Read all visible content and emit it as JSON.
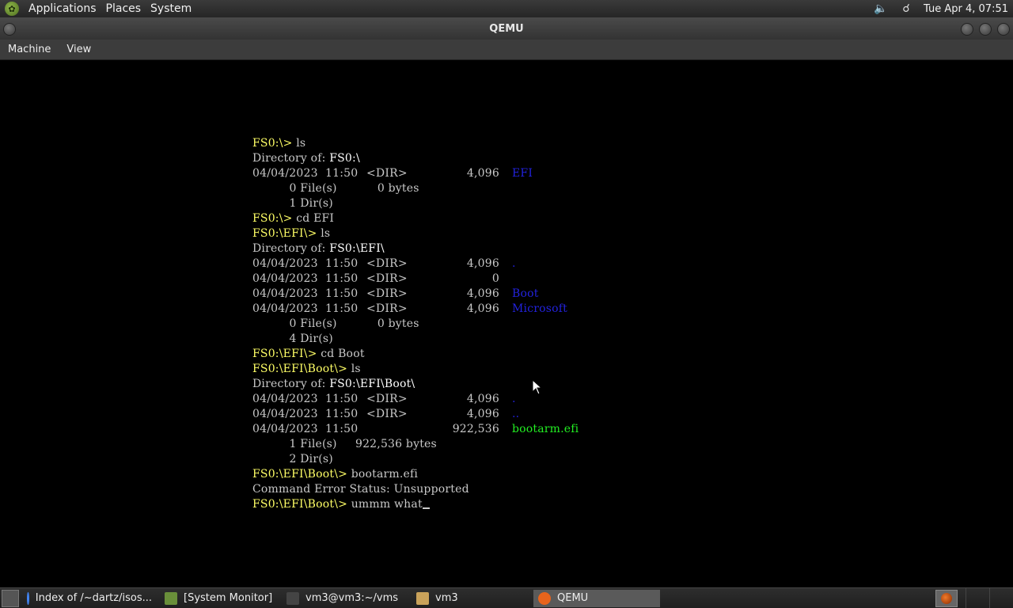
{
  "top_panel": {
    "menus": [
      "Applications",
      "Places",
      "System"
    ],
    "clock": "Tue Apr  4, 07:51"
  },
  "window": {
    "title": "QEMU"
  },
  "menubar": [
    "Machine",
    "View"
  ],
  "console": {
    "lines": [
      {
        "prompt": "FS0:\\> ",
        "cmd": "ls"
      },
      {
        "label": "Directory of: ",
        "path": "FS0:\\"
      },
      {
        "date": "04/04/2023  11:50",
        "type": "<DIR>",
        "size": "4,096",
        "name": "EFI",
        "kind": "dir"
      },
      {
        "summary": "          0 File(s)           0 bytes"
      },
      {
        "summary": "          1 Dir(s)"
      },
      {
        "prompt": "FS0:\\> ",
        "cmd": "cd EFI"
      },
      {
        "prompt": "FS0:\\EFI\\> ",
        "cmd": "ls"
      },
      {
        "label": "Directory of: ",
        "path": "FS0:\\EFI\\"
      },
      {
        "date": "04/04/2023  11:50",
        "type": "<DIR>",
        "size": "4,096",
        "name": ".",
        "kind": "dir"
      },
      {
        "date": "04/04/2023  11:50",
        "type": "<DIR>",
        "size": "0",
        "name": "",
        "kind": "dir"
      },
      {
        "date": "04/04/2023  11:50",
        "type": "<DIR>",
        "size": "4,096",
        "name": "Boot",
        "kind": "dir"
      },
      {
        "date": "04/04/2023  11:50",
        "type": "<DIR>",
        "size": "4,096",
        "name": "Microsoft",
        "kind": "dir"
      },
      {
        "summary": "          0 File(s)           0 bytes"
      },
      {
        "summary": "          4 Dir(s)"
      },
      {
        "prompt": "FS0:\\EFI\\> ",
        "cmd": "cd Boot"
      },
      {
        "prompt": "FS0:\\EFI\\Boot\\> ",
        "cmd": "ls"
      },
      {
        "label": "Directory of: ",
        "path": "FS0:\\EFI\\Boot\\"
      },
      {
        "date": "04/04/2023  11:50",
        "type": "<DIR>",
        "size": "4,096",
        "name": ".",
        "kind": "dir"
      },
      {
        "date": "04/04/2023  11:50",
        "type": "<DIR>",
        "size": "4,096",
        "name": "..",
        "kind": "dir"
      },
      {
        "date": "04/04/2023  11:50",
        "type": "",
        "size": "922,536",
        "name": "bootarm.efi",
        "kind": "efi"
      },
      {
        "summary": "          1 File(s)     922,536 bytes"
      },
      {
        "summary": "          2 Dir(s)"
      },
      {
        "prompt": "FS0:\\EFI\\Boot\\> ",
        "cmd": "bootarm.efi"
      },
      {
        "summary": "Command Error Status: Unsupported"
      },
      {
        "prompt": "FS0:\\EFI\\Boot\\> ",
        "cmd": "ummm what",
        "cursor": true
      }
    ]
  },
  "taskbar": {
    "tasks": [
      {
        "label": "Index of /~dartz/isos...",
        "icon": "chrome-icon",
        "color": "#4285f4"
      },
      {
        "label": "[System Monitor]",
        "icon": "system-monitor-icon",
        "color": "#6a8f3a"
      },
      {
        "label": "vm3@vm3:~/vms",
        "icon": "terminal-icon",
        "color": "#444444"
      },
      {
        "label": "vm3",
        "icon": "folder-icon",
        "color": "#c9a25a"
      },
      {
        "label": "QEMU",
        "icon": "qemu-icon",
        "color": "#e8641c",
        "active": true
      }
    ]
  }
}
